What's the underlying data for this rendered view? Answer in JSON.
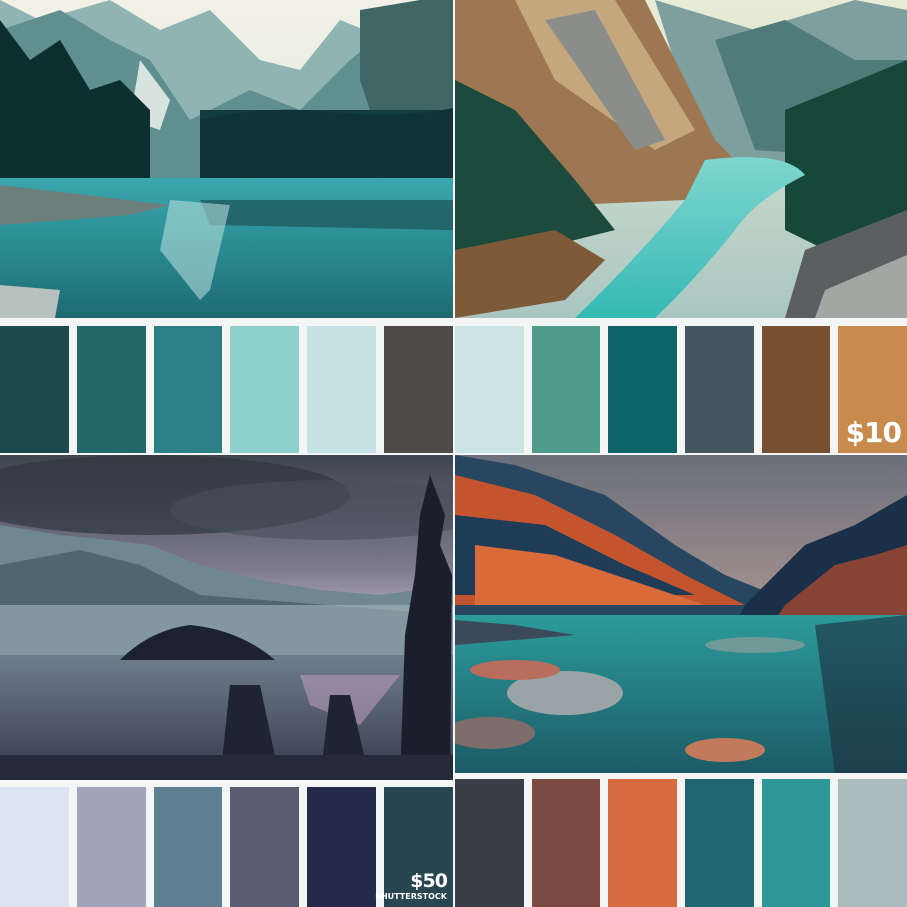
{
  "panels": {
    "top_left": {
      "swatches": [
        "#1c4a4c",
        "#23676a",
        "#2d8186",
        "#8dd0cc",
        "#c5e1e3",
        "#4d4a48"
      ]
    },
    "top_right": {
      "swatches": [
        "#c9e4e2",
        "#4f9b8c",
        "#0d6468",
        "#45555f",
        "#765031",
        "#c88a4d"
      ],
      "price": "$10"
    },
    "bottom_left": {
      "swatches": [
        "#dbe5f1",
        "#a5a3bb",
        "#5f7f93",
        "#5d5b6f",
        "#252a4d",
        "#27464f"
      ],
      "price": "$50",
      "price_caption": "SHUTTERSTOCK"
    },
    "bottom_right": {
      "swatches": [
        "#3c3d47",
        "#7b4a40",
        "#d76a3f",
        "#1e6670",
        "#2e9897",
        "#aabcbc"
      ]
    }
  }
}
